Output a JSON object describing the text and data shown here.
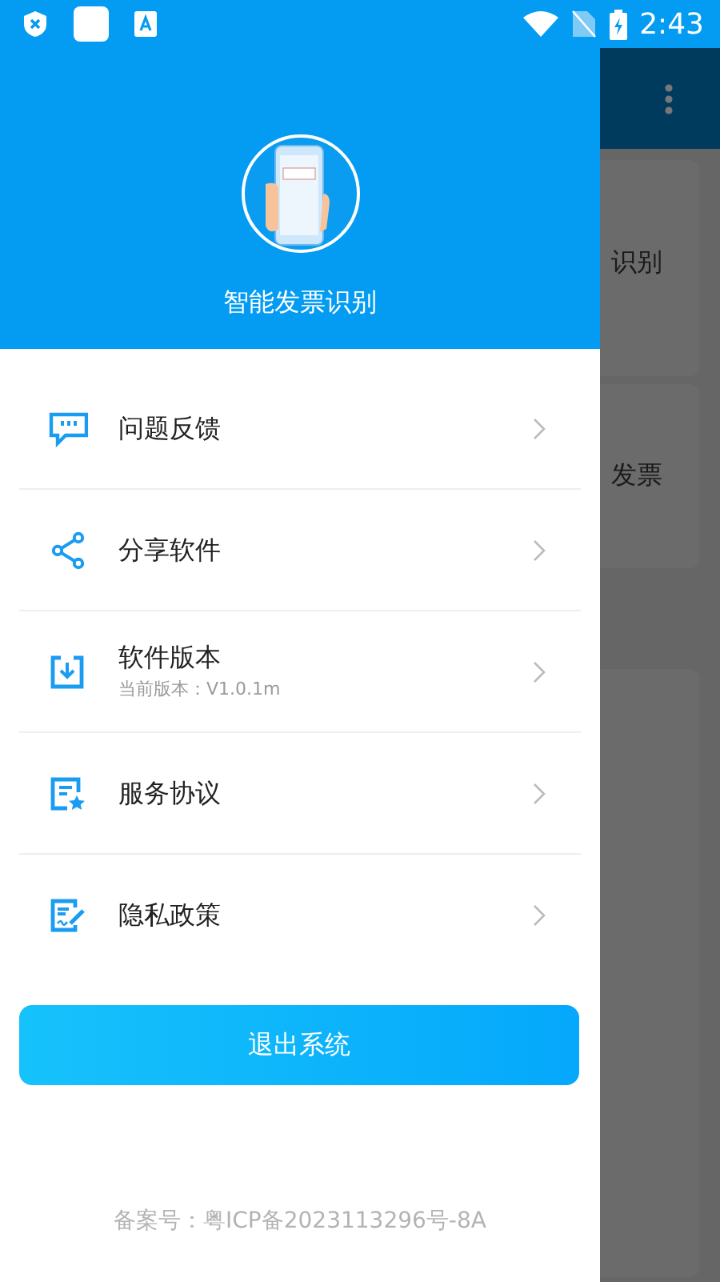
{
  "status_bar": {
    "time": "2:43"
  },
  "drawer": {
    "title": "智能发票识别",
    "menu": [
      {
        "label": "问题反馈"
      },
      {
        "label": "分享软件"
      },
      {
        "label": "软件版本",
        "subtitle": "当前版本：V1.0.1m"
      },
      {
        "label": "服务协议"
      },
      {
        "label": "隐私政策"
      }
    ],
    "logout_button": "退出系统",
    "footer": "备案号：粤ICP备2023113296号-8A"
  },
  "background_screen": {
    "items": [
      "识别",
      "发票"
    ]
  }
}
